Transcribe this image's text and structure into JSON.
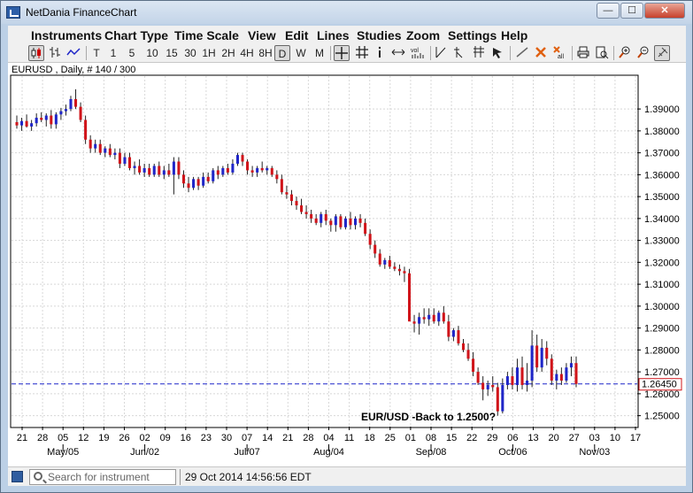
{
  "window": {
    "title": "NetDania FinanceChart",
    "controls": {
      "minimize": "—",
      "maximize": "☐",
      "close": "✕"
    }
  },
  "menu": [
    "Instruments",
    "Chart Type",
    "Time Scale",
    "View",
    "Edit",
    "Lines",
    "Studies",
    "Zoom",
    "Settings",
    "Help"
  ],
  "toolbar": {
    "timescales": [
      "T",
      "1",
      "5",
      "10",
      "15",
      "30",
      "1H",
      "2H",
      "4H",
      "8H",
      "D",
      "W",
      "M"
    ],
    "selected_timescale": "D",
    "icons": [
      "candlestick-icon",
      "ohlc-bar-icon",
      "line-chart-icon",
      "crosshair-icon",
      "grid-icon",
      "info-icon",
      "scroll-icon",
      "volume-icon",
      "trendline-icon",
      "fibonacci-icon",
      "andrews-fork-icon",
      "select-arrow-icon",
      "draw-line-icon",
      "delete-icon",
      "delete-all-icon",
      "print-icon",
      "print-preview-icon",
      "zoom-in-icon",
      "zoom-out-icon",
      "pin-icon"
    ]
  },
  "chart": {
    "header": "EURUSD , Daily, # 140 / 300",
    "annotation": "EUR/USD -Back to 1.2500?",
    "current_price_label": "1.26450",
    "current_price": 1.2645,
    "colors": {
      "up": "#1f26c8",
      "down": "#d0141a",
      "line": "#1f26c8",
      "grid": "#d8d8d8"
    }
  },
  "chart_data": {
    "type": "candlestick",
    "instrument": "EURUSD",
    "timeframe": "Daily",
    "ylim": [
      1.245,
      1.405
    ],
    "y_ticks": [
      "1.39000",
      "1.38000",
      "1.37000",
      "1.36000",
      "1.35000",
      "1.34000",
      "1.33000",
      "1.32000",
      "1.31000",
      "1.30000",
      "1.29000",
      "1.28000",
      "1.27000",
      "1.26000",
      "1.25000"
    ],
    "x_ticks": [
      "21",
      "28",
      "05",
      "12",
      "19",
      "26",
      "02",
      "09",
      "16",
      "23",
      "30",
      "07",
      "14",
      "21",
      "28",
      "04",
      "11",
      "18",
      "25",
      "01",
      "08",
      "15",
      "22",
      "29",
      "06",
      "13",
      "20",
      "27",
      "03",
      "10",
      "17"
    ],
    "month_labels": [
      {
        "label": "May/05",
        "tick_index": 2
      },
      {
        "label": "Jun/02",
        "tick_index": 6
      },
      {
        "label": "Jul/07",
        "tick_index": 11
      },
      {
        "label": "Aug/04",
        "tick_index": 15
      },
      {
        "label": "Sep/08",
        "tick_index": 20
      },
      {
        "label": "Oct/06",
        "tick_index": 24
      },
      {
        "label": "Nov/03",
        "tick_index": 28
      }
    ],
    "candles": [
      [
        1.384,
        1.387,
        1.381,
        1.3825
      ],
      [
        1.3825,
        1.386,
        1.38,
        1.3845
      ],
      [
        1.3845,
        1.3875,
        1.3815,
        1.382
      ],
      [
        1.382,
        1.385,
        1.38,
        1.3835
      ],
      [
        1.3835,
        1.388,
        1.382,
        1.386
      ],
      [
        1.386,
        1.3885,
        1.384,
        1.385
      ],
      [
        1.385,
        1.388,
        1.382,
        1.387
      ],
      [
        1.387,
        1.3895,
        1.381,
        1.383
      ],
      [
        1.383,
        1.3885,
        1.381,
        1.3875
      ],
      [
        1.3875,
        1.3905,
        1.385,
        1.389
      ],
      [
        1.389,
        1.392,
        1.387,
        1.39
      ],
      [
        1.39,
        1.396,
        1.389,
        1.3945
      ],
      [
        1.3945,
        1.399,
        1.39,
        1.391
      ],
      [
        1.391,
        1.393,
        1.384,
        1.385
      ],
      [
        1.385,
        1.387,
        1.374,
        1.376
      ],
      [
        1.376,
        1.378,
        1.37,
        1.372
      ],
      [
        1.372,
        1.376,
        1.37,
        1.374
      ],
      [
        1.374,
        1.376,
        1.369,
        1.37
      ],
      [
        1.37,
        1.373,
        1.368,
        1.372
      ],
      [
        1.372,
        1.374,
        1.368,
        1.369
      ],
      [
        1.369,
        1.372,
        1.367,
        1.37
      ],
      [
        1.37,
        1.372,
        1.363,
        1.365
      ],
      [
        1.365,
        1.37,
        1.364,
        1.368
      ],
      [
        1.368,
        1.37,
        1.362,
        1.363
      ],
      [
        1.363,
        1.366,
        1.36,
        1.364
      ],
      [
        1.364,
        1.367,
        1.36,
        1.361
      ],
      [
        1.361,
        1.365,
        1.359,
        1.363
      ],
      [
        1.363,
        1.365,
        1.359,
        1.36
      ],
      [
        1.36,
        1.365,
        1.359,
        1.364
      ],
      [
        1.364,
        1.366,
        1.359,
        1.36
      ],
      [
        1.36,
        1.364,
        1.358,
        1.362
      ],
      [
        1.362,
        1.365,
        1.359,
        1.36
      ],
      [
        1.36,
        1.368,
        1.351,
        1.366
      ],
      [
        1.366,
        1.368,
        1.358,
        1.36
      ],
      [
        1.36,
        1.362,
        1.354,
        1.356
      ],
      [
        1.356,
        1.359,
        1.352,
        1.354
      ],
      [
        1.354,
        1.359,
        1.353,
        1.358
      ],
      [
        1.358,
        1.359,
        1.353,
        1.355
      ],
      [
        1.355,
        1.361,
        1.354,
        1.359
      ],
      [
        1.359,
        1.361,
        1.356,
        1.357
      ],
      [
        1.357,
        1.363,
        1.356,
        1.362
      ],
      [
        1.362,
        1.364,
        1.358,
        1.36
      ],
      [
        1.36,
        1.364,
        1.359,
        1.363
      ],
      [
        1.363,
        1.365,
        1.36,
        1.361
      ],
      [
        1.361,
        1.367,
        1.36,
        1.365
      ],
      [
        1.365,
        1.37,
        1.364,
        1.369
      ],
      [
        1.369,
        1.37,
        1.364,
        1.366
      ],
      [
        1.366,
        1.367,
        1.36,
        1.362
      ],
      [
        1.362,
        1.364,
        1.359,
        1.361
      ],
      [
        1.361,
        1.364,
        1.359,
        1.363
      ],
      [
        1.363,
        1.366,
        1.361,
        1.362
      ],
      [
        1.362,
        1.364,
        1.36,
        1.363
      ],
      [
        1.363,
        1.364,
        1.359,
        1.36
      ],
      [
        1.36,
        1.362,
        1.356,
        1.358
      ],
      [
        1.358,
        1.36,
        1.351,
        1.352
      ],
      [
        1.352,
        1.355,
        1.349,
        1.351
      ],
      [
        1.351,
        1.353,
        1.346,
        1.348
      ],
      [
        1.348,
        1.35,
        1.344,
        1.346
      ],
      [
        1.346,
        1.349,
        1.342,
        1.343
      ],
      [
        1.343,
        1.346,
        1.34,
        1.342
      ],
      [
        1.342,
        1.344,
        1.338,
        1.34
      ],
      [
        1.34,
        1.342,
        1.337,
        1.338
      ],
      [
        1.338,
        1.343,
        1.336,
        1.342
      ],
      [
        1.342,
        1.344,
        1.337,
        1.339
      ],
      [
        1.339,
        1.34,
        1.334,
        1.337
      ],
      [
        1.337,
        1.342,
        1.334,
        1.341
      ],
      [
        1.341,
        1.342,
        1.335,
        1.336
      ],
      [
        1.336,
        1.341,
        1.335,
        1.34
      ],
      [
        1.34,
        1.343,
        1.335,
        1.337
      ],
      [
        1.337,
        1.341,
        1.335,
        1.34
      ],
      [
        1.34,
        1.342,
        1.336,
        1.338
      ],
      [
        1.338,
        1.34,
        1.332,
        1.333
      ],
      [
        1.333,
        1.335,
        1.326,
        1.328
      ],
      [
        1.328,
        1.33,
        1.322,
        1.324
      ],
      [
        1.324,
        1.326,
        1.318,
        1.319
      ],
      [
        1.319,
        1.322,
        1.317,
        1.321
      ],
      [
        1.321,
        1.323,
        1.317,
        1.318
      ],
      [
        1.318,
        1.32,
        1.316,
        1.317
      ],
      [
        1.317,
        1.319,
        1.314,
        1.316
      ],
      [
        1.316,
        1.318,
        1.311,
        1.315
      ],
      [
        1.315,
        1.317,
        1.302,
        1.293
      ],
      [
        1.293,
        1.296,
        1.288,
        1.292
      ],
      [
        1.292,
        1.297,
        1.287,
        1.295
      ],
      [
        1.295,
        1.299,
        1.292,
        1.294
      ],
      [
        1.294,
        1.299,
        1.291,
        1.296
      ],
      [
        1.296,
        1.299,
        1.292,
        1.293
      ],
      [
        1.293,
        1.298,
        1.291,
        1.297
      ],
      [
        1.297,
        1.3,
        1.292,
        1.293
      ],
      [
        1.293,
        1.296,
        1.284,
        1.286
      ],
      [
        1.286,
        1.29,
        1.284,
        1.289
      ],
      [
        1.289,
        1.291,
        1.282,
        1.283
      ],
      [
        1.283,
        1.285,
        1.279,
        1.28
      ],
      [
        1.28,
        1.283,
        1.275,
        1.276
      ],
      [
        1.276,
        1.279,
        1.268,
        1.27
      ],
      [
        1.27,
        1.272,
        1.264,
        1.265
      ],
      [
        1.265,
        1.268,
        1.257,
        1.262
      ],
      [
        1.262,
        1.266,
        1.259,
        1.264
      ],
      [
        1.264,
        1.268,
        1.261,
        1.263
      ],
      [
        1.263,
        1.265,
        1.25,
        1.252
      ],
      [
        1.252,
        1.267,
        1.251,
        1.264
      ],
      [
        1.264,
        1.27,
        1.262,
        1.268
      ],
      [
        1.268,
        1.272,
        1.262,
        1.264
      ],
      [
        1.264,
        1.276,
        1.261,
        1.272
      ],
      [
        1.272,
        1.277,
        1.262,
        1.264
      ],
      [
        1.264,
        1.274,
        1.261,
        1.266
      ],
      [
        1.266,
        1.289,
        1.263,
        1.282
      ],
      [
        1.282,
        1.287,
        1.27,
        1.272
      ],
      [
        1.272,
        1.285,
        1.27,
        1.281
      ],
      [
        1.281,
        1.284,
        1.273,
        1.276
      ],
      [
        1.276,
        1.278,
        1.264,
        1.266
      ],
      [
        1.266,
        1.271,
        1.262,
        1.269
      ],
      [
        1.269,
        1.272,
        1.264,
        1.266
      ],
      [
        1.266,
        1.274,
        1.265,
        1.272
      ],
      [
        1.272,
        1.277,
        1.268,
        1.274
      ],
      [
        1.274,
        1.277,
        1.263,
        1.2645
      ]
    ]
  },
  "statusbar": {
    "search_placeholder": "Search for instrument",
    "datetime": "29 Oct 2014 14:56:56 EDT"
  }
}
